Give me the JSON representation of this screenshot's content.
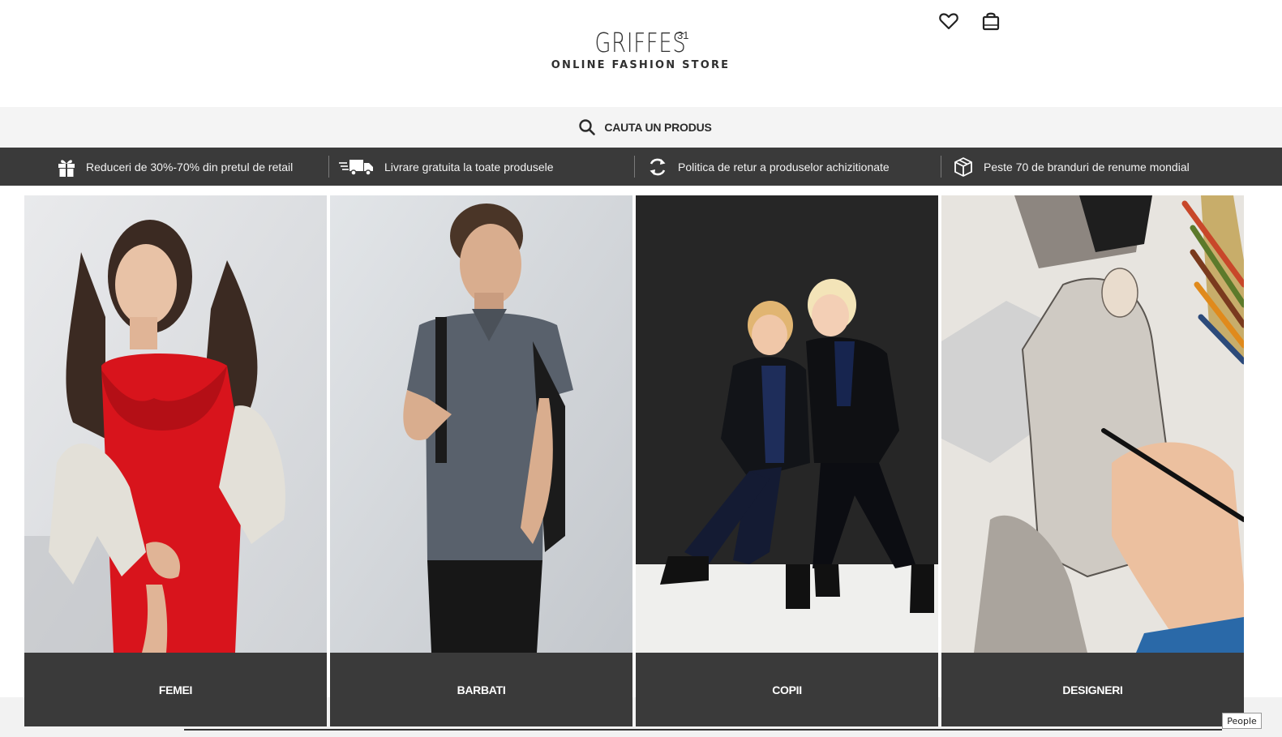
{
  "header": {
    "logo_name": "GRIFFES",
    "logo_sup": "31",
    "logo_tagline": "ONLINE FASHION STORE",
    "wishlist_icon": "heart-icon",
    "cart_icon": "shopping-bag-icon"
  },
  "search": {
    "label": "CAUTA UN PRODUS",
    "icon": "search-icon"
  },
  "benefits": [
    {
      "icon": "gift-icon",
      "text": "Reduceri de 30%-70% din pretul de retail"
    },
    {
      "icon": "delivery-truck-icon",
      "text": "Livrare gratuita la toate produsele"
    },
    {
      "icon": "refresh-icon",
      "text": "Politica de retur a produselor achizitionate"
    },
    {
      "icon": "box-icon",
      "text": "Peste 70 de branduri de renume mondial"
    }
  ],
  "categories": [
    {
      "label": "FEMEI",
      "image": "woman-in-red-ruffled-top-photo"
    },
    {
      "label": "BARBATI",
      "image": "man-in-grey-polo-with-backpack-photo"
    },
    {
      "label": "COPII",
      "image": "two-boys-in-black-jackets-photo"
    },
    {
      "label": "DESIGNERI",
      "image": "hand-drawing-fashion-sketch-photo"
    }
  ],
  "overlay": {
    "people_chip": "People"
  },
  "colors": {
    "dark_band": "#3a3a3a",
    "search_band": "#f4f4f4",
    "accent_red": "#d8141c"
  }
}
